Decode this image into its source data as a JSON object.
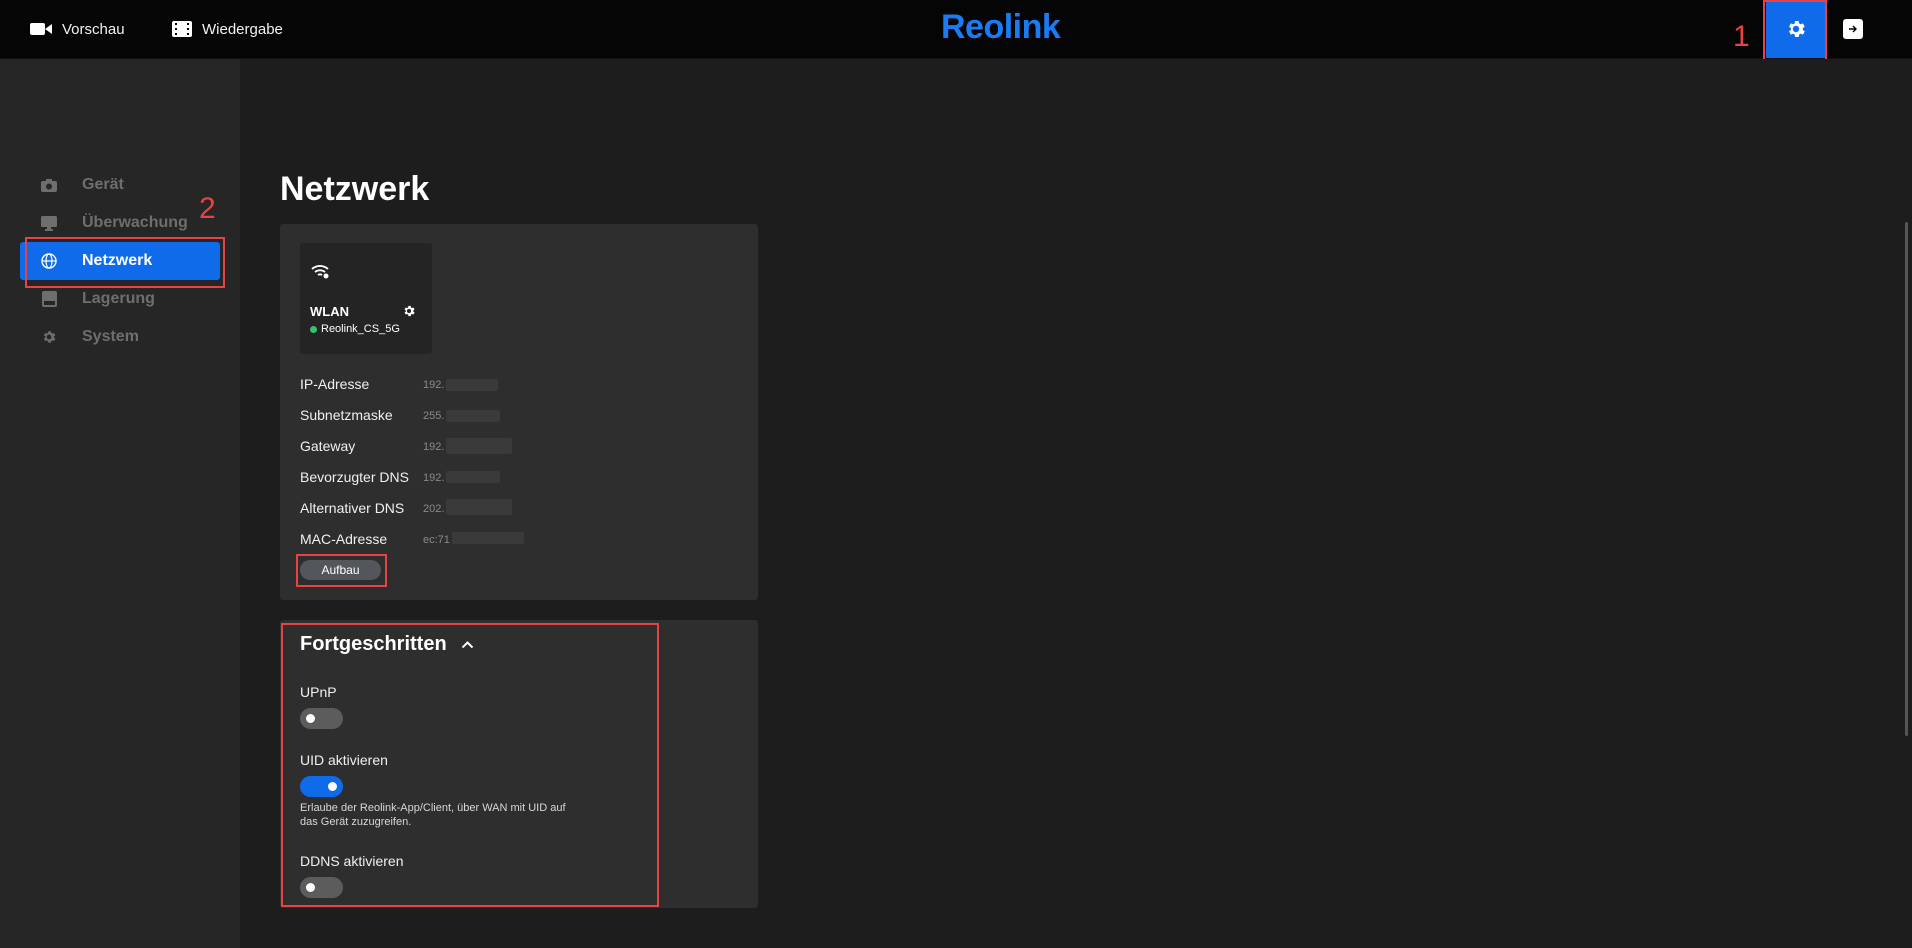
{
  "topbar": {
    "preview_label": "Vorschau",
    "playback_label": "Wiedergabe",
    "logo_text": "Reolink",
    "settings_icon": "gear-icon",
    "logout_icon": "logout-icon"
  },
  "annotations": {
    "step1": "1",
    "step2": "2"
  },
  "sidebar": {
    "items": [
      {
        "label": "Gerät",
        "icon": "camera-icon",
        "active": false
      },
      {
        "label": "Überwachung",
        "icon": "monitor-icon",
        "active": false
      },
      {
        "label": "Netzwerk",
        "icon": "globe-icon",
        "active": true
      },
      {
        "label": "Lagerung",
        "icon": "storage-icon",
        "active": false
      },
      {
        "label": "System",
        "icon": "gear-icon",
        "active": false
      }
    ]
  },
  "main": {
    "title": "Netzwerk",
    "wlan": {
      "name": "WLAN",
      "ssid": "Reolink_CS_5G",
      "status_color": "#38c172"
    },
    "network": {
      "rows": [
        {
          "label": "IP-Adresse",
          "value": "192."
        },
        {
          "label": "Subnetzmaske",
          "value": "255."
        },
        {
          "label": "Gateway",
          "value": "192."
        },
        {
          "label": "Bevorzugter DNS",
          "value": "192."
        },
        {
          "label": "Alternativer DNS",
          "value": "202."
        },
        {
          "label": "MAC-Adresse",
          "value": "ec:71"
        }
      ],
      "setup_button": "Aufbau"
    },
    "advanced": {
      "title": "Fortgeschritten",
      "upnp": {
        "label": "UPnP",
        "enabled": false
      },
      "uid": {
        "label": "UID aktivieren",
        "enabled": true,
        "description": "Erlaube der Reolink-App/Client, über WAN mit UID auf das Gerät zuzugreifen."
      },
      "ddns": {
        "label": "DDNS aktivieren",
        "enabled": false
      }
    }
  },
  "colors": {
    "accent": "#0f6bea",
    "annotation": "#e64444"
  }
}
